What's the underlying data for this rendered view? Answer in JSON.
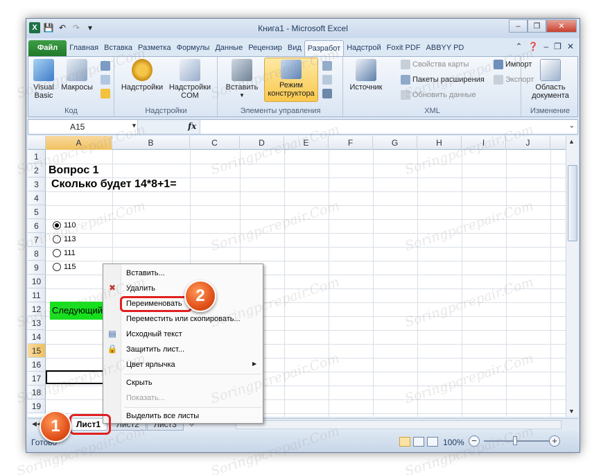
{
  "window": {
    "title": "Книга1 - Microsoft Excel"
  },
  "ribbon_tabs": [
    "Файл",
    "Главная",
    "Вставка",
    "Разметка",
    "Формулы",
    "Данные",
    "Рецензир",
    "Вид",
    "Разработ",
    "Надстрой",
    "Foxit PDF",
    "ABBYY PD"
  ],
  "ribbon": {
    "code": {
      "label": "Код",
      "visual_basic": "Visual\nBasic",
      "macros": "Макросы"
    },
    "addins": {
      "label": "Надстройки",
      "addins_btn": "Надстройки",
      "com_btn": "Надстройки\nCOM"
    },
    "controls": {
      "label": "Элементы управления",
      "insert": "Вставить",
      "design_mode": "Режим\nконструктора"
    },
    "xml": {
      "label": "XML",
      "source": "Источник",
      "map_props": "Свойства карты",
      "expansion": "Пакеты расширения",
      "refresh": "Обновить данные",
      "import": "Импорт",
      "export": "Экспорт"
    },
    "modify": {
      "label": "Изменение",
      "doc_panel": "Область\nдокумента"
    }
  },
  "formula_bar": {
    "name_box": "A15",
    "fx": "fx",
    "value": ""
  },
  "columns": [
    "A",
    "B",
    "C",
    "D",
    "E",
    "F",
    "G",
    "H",
    "I",
    "J"
  ],
  "rows": [
    "1",
    "2",
    "3",
    "4",
    "5",
    "6",
    "7",
    "8",
    "9",
    "10",
    "11",
    "12",
    "13",
    "14",
    "15",
    "16",
    "17",
    "18",
    "19"
  ],
  "cells": {
    "a2": "Вопрос 1",
    "a3": "Сколько будет 14*8+1="
  },
  "radio_options": [
    {
      "label": "110",
      "checked": true
    },
    {
      "label": "113",
      "checked": false
    },
    {
      "label": "111",
      "checked": false
    },
    {
      "label": "115",
      "checked": false
    }
  ],
  "next_button": "Следующий",
  "context_menu": {
    "items": [
      "Вставить...",
      "Удалить",
      "Переименовать",
      "Переместить или скопировать...",
      "Исходный текст",
      "Защитить лист...",
      "Цвет ярлычка",
      "Скрыть",
      "Показать...",
      "Выделить все листы"
    ],
    "disabled": [
      "Показать..."
    ]
  },
  "sheets": [
    "Лист1",
    "Лист2",
    "Лист3"
  ],
  "status": {
    "ready": "Готово",
    "zoom": "100%"
  },
  "badges": {
    "one": "1",
    "two": "2"
  },
  "watermark": "Soringpcrepair.Com",
  "colors": {
    "file_tab": "#2a8a35",
    "next_button": "#16e01c",
    "badge": "#e2531b",
    "highlight": "#e02020",
    "design_mode": "#f9c84e"
  },
  "icons": [
    "excel-logo-icon",
    "save-icon",
    "undo-icon",
    "redo-icon",
    "help-icon",
    "visual-basic-icon",
    "macros-icon",
    "addins-gear-icon",
    "com-addins-icon",
    "insert-control-icon",
    "design-mode-icon",
    "source-icon",
    "document-panel-icon"
  ]
}
